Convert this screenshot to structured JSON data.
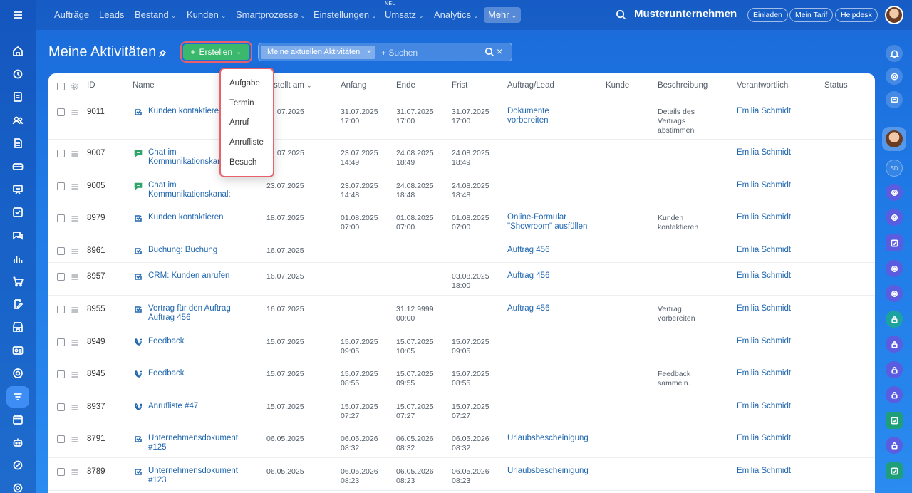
{
  "topnav": {
    "items": [
      {
        "label": "Aufträge",
        "chevron": false
      },
      {
        "label": "Leads",
        "chevron": false
      },
      {
        "label": "Bestand",
        "chevron": true
      },
      {
        "label": "Kunden",
        "chevron": true
      },
      {
        "label": "Smartprozesse",
        "chevron": true
      },
      {
        "label": "Einstellungen",
        "chevron": true
      },
      {
        "label": "Umsatz",
        "chevron": true,
        "badge": "NEU"
      },
      {
        "label": "Analytics",
        "chevron": true
      },
      {
        "label": "Mehr",
        "chevron": true,
        "active": true
      }
    ],
    "company": "Musterunternehmen",
    "pills": [
      "Einladen",
      "Mein Tarif",
      "Helpdesk"
    ]
  },
  "page": {
    "title": "Meine Aktivitäten",
    "create_label": "Erstellen",
    "filter_chip": "Meine aktuellen Aktivitäten",
    "search_placeholder": "+ Suchen"
  },
  "menu": {
    "items": [
      "Aufgabe",
      "Termin",
      "Anruf",
      "Anrufliste",
      "Besuch"
    ]
  },
  "table": {
    "columns": {
      "id": "ID",
      "name": "Name",
      "created": "stellt am",
      "start": "Anfang",
      "end": "Ende",
      "deadline": "Frist",
      "order": "Auftrag/Lead",
      "client": "Kunde",
      "description": "Beschreibung",
      "responsible": "Verantwortlich",
      "status": "Status"
    },
    "rows": [
      {
        "id": "9011",
        "icon": "task",
        "name": [
          "Kunden kontaktieren"
        ],
        "created": ".07.2025",
        "start": [
          "31.07.2025",
          "17:00"
        ],
        "end": [
          "31.07.2025",
          "17:00"
        ],
        "deadline": [
          "31.07.2025",
          "17:00"
        ],
        "order": [
          "Dokumente",
          "vorbereiten"
        ],
        "description": [
          "Details des",
          "Vertrags",
          "abstimmen"
        ],
        "responsible": "Emilia Schmidt"
      },
      {
        "id": "9007",
        "icon": "chat",
        "name": [
          "Chat im",
          "Kommunikationskanal"
        ],
        "created": ".07.2025",
        "start": [
          "23.07.2025",
          "14:49"
        ],
        "end": [
          "24.08.2025",
          "18:49"
        ],
        "deadline": [
          "24.08.2025",
          "18:49"
        ],
        "order": [],
        "description": [],
        "responsible": "Emilia Schmidt"
      },
      {
        "id": "9005",
        "icon": "chat",
        "name": [
          "Chat im",
          "Kommunikationskanal:"
        ],
        "created": "23.07.2025",
        "start": [
          "23.07.2025",
          "14:48"
        ],
        "end": [
          "24.08.2025",
          "18:48"
        ],
        "deadline": [
          "24.08.2025",
          "18:48"
        ],
        "order": [],
        "description": [],
        "responsible": "Emilia Schmidt"
      },
      {
        "id": "8979",
        "icon": "task",
        "name": [
          "Kunden kontaktieren"
        ],
        "created": "18.07.2025",
        "start": [
          "01.08.2025",
          "07:00"
        ],
        "end": [
          "01.08.2025",
          "07:00"
        ],
        "deadline": [
          "01.08.2025",
          "07:00"
        ],
        "order": [
          "Online-Formular",
          "\"Showroom\" ausfüllen"
        ],
        "description": [
          "Kunden",
          "kontaktieren"
        ],
        "responsible": "Emilia Schmidt"
      },
      {
        "id": "8961",
        "icon": "task",
        "name": [
          "Buchung: Buchung"
        ],
        "created": "16.07.2025",
        "start": [],
        "end": [],
        "deadline": [],
        "order": [
          "Auftrag 456"
        ],
        "description": [],
        "responsible": "Emilia Schmidt"
      },
      {
        "id": "8957",
        "icon": "task",
        "name": [
          "CRM: Kunden anrufen"
        ],
        "created": "16.07.2025",
        "start": [],
        "end": [],
        "deadline": [
          "03.08.2025",
          "18:00"
        ],
        "order": [
          "Auftrag 456"
        ],
        "description": [],
        "responsible": "Emilia Schmidt"
      },
      {
        "id": "8955",
        "icon": "task",
        "name": [
          "Vertrag für den Auftrag",
          "Auftrag 456"
        ],
        "created": "16.07.2025",
        "start": [],
        "end": [
          "31.12.9999",
          "00:00"
        ],
        "deadline": [],
        "order": [
          "Auftrag 456"
        ],
        "description": [
          "Vertrag",
          "vorbereiten"
        ],
        "responsible": "Emilia Schmidt"
      },
      {
        "id": "8949",
        "icon": "call",
        "name": [
          "Feedback"
        ],
        "created": "15.07.2025",
        "start": [
          "15.07.2025",
          "09:05"
        ],
        "end": [
          "15.07.2025",
          "10:05"
        ],
        "deadline": [
          "15.07.2025",
          "09:05"
        ],
        "order": [],
        "description": [],
        "responsible": "Emilia Schmidt"
      },
      {
        "id": "8945",
        "icon": "call",
        "name": [
          "Feedback"
        ],
        "created": "15.07.2025",
        "start": [
          "15.07.2025",
          "08:55"
        ],
        "end": [
          "15.07.2025",
          "09:55"
        ],
        "deadline": [
          "15.07.2025",
          "08:55"
        ],
        "order": [],
        "description": [
          "Feedback",
          "sammeln."
        ],
        "responsible": "Emilia Schmidt"
      },
      {
        "id": "8937",
        "icon": "call",
        "name": [
          "Anrufliste #47"
        ],
        "created": "15.07.2025",
        "start": [
          "15.07.2025",
          "07:27"
        ],
        "end": [
          "15.07.2025",
          "07:27"
        ],
        "deadline": [
          "15.07.2025",
          "07:27"
        ],
        "order": [],
        "description": [],
        "responsible": "Emilia Schmidt"
      },
      {
        "id": "8791",
        "icon": "task",
        "name": [
          "Unternehmensdokument",
          "#125"
        ],
        "created": "06.05.2025",
        "start": [
          "06.05.2026",
          "08:32"
        ],
        "end": [
          "06.05.2026",
          "08:32"
        ],
        "deadline": [
          "06.05.2026",
          "08:32"
        ],
        "order": [
          "Urlaubsbescheinigung"
        ],
        "description": [],
        "responsible": "Emilia Schmidt"
      },
      {
        "id": "8789",
        "icon": "task",
        "name": [
          "Unternehmensdokument",
          "#123"
        ],
        "created": "06.05.2025",
        "start": [
          "06.05.2026",
          "08:23"
        ],
        "end": [
          "06.05.2026",
          "08:23"
        ],
        "deadline": [
          "06.05.2026",
          "08:23"
        ],
        "order": [
          "Urlaubsbescheinigung"
        ],
        "description": [],
        "responsible": "Emilia Schmidt"
      }
    ]
  },
  "colors": {
    "accent_green": "#3ab86b",
    "highlight_red": "#e8616a",
    "link_blue": "#2067b0",
    "chat_green": "#2fa36a"
  }
}
